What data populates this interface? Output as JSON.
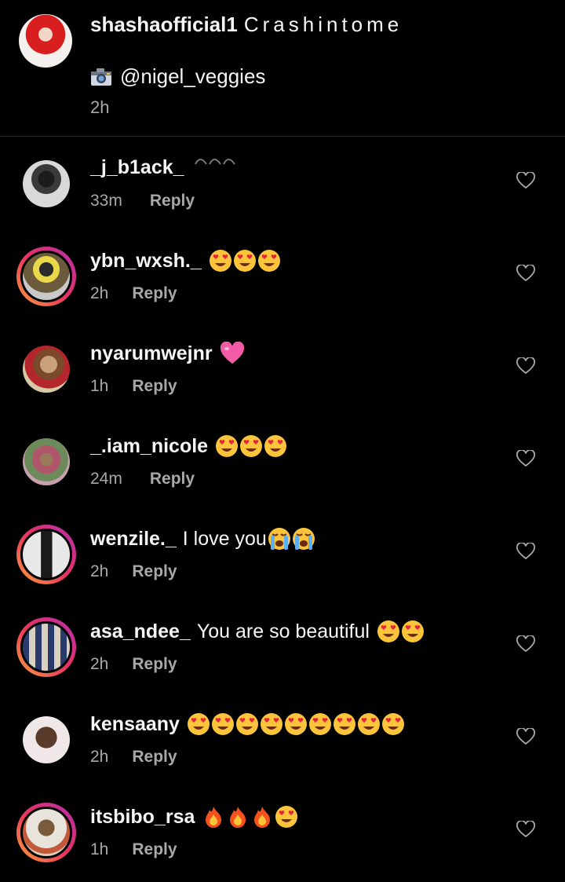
{
  "caption": {
    "username": "shashaofficial1",
    "text": "Crashintome",
    "mention": "@nigel_veggies",
    "time": "2h"
  },
  "reply_label": "Reply",
  "colors": {
    "background": "#000000",
    "primary_text": "#f5f5f5",
    "secondary_text": "#a8a8a8",
    "divider": "#262626",
    "story_ring_start": "#f9a33b",
    "story_ring_end": "#b12fb1"
  },
  "comments": [
    {
      "username": "_j_b1ack_",
      "text": "",
      "emojis": [],
      "time": "33m",
      "reply": "Reply",
      "story_ring": false
    },
    {
      "username": "ybn_wxsh._",
      "text": "",
      "emojis": [
        "heart-eyes",
        "heart-eyes",
        "heart-eyes"
      ],
      "time": "2h",
      "reply": "Reply",
      "story_ring": true
    },
    {
      "username": "nyarumwejnr",
      "text": "",
      "emojis": [
        "pink-heart"
      ],
      "time": "1h",
      "reply": "Reply",
      "story_ring": false
    },
    {
      "username": "_.iam_nicole",
      "text": "",
      "emojis": [
        "heart-eyes",
        "heart-eyes",
        "heart-eyes"
      ],
      "time": "24m",
      "reply": "Reply",
      "story_ring": false
    },
    {
      "username": "wenzile._",
      "text": "I love you",
      "emojis": [
        "crying",
        "crying"
      ],
      "time": "2h",
      "reply": "Reply",
      "story_ring": true
    },
    {
      "username": "asa_ndee_",
      "text": "You are so beautiful",
      "emojis": [
        "heart-eyes",
        "heart-eyes"
      ],
      "time": "2h",
      "reply": "Reply",
      "story_ring": true
    },
    {
      "username": "kensaany",
      "text": "",
      "emojis": [
        "heart-eyes",
        "heart-eyes",
        "heart-eyes",
        "heart-eyes",
        "heart-eyes",
        "heart-eyes",
        "heart-eyes",
        "heart-eyes",
        "heart-eyes"
      ],
      "time": "2h",
      "reply": "Reply",
      "story_ring": false
    },
    {
      "username": "itsbibo_rsa",
      "text": "",
      "emojis": [
        "fire",
        "fire",
        "fire",
        "heart-eyes"
      ],
      "time": "1h",
      "reply": "Reply",
      "story_ring": true
    }
  ]
}
